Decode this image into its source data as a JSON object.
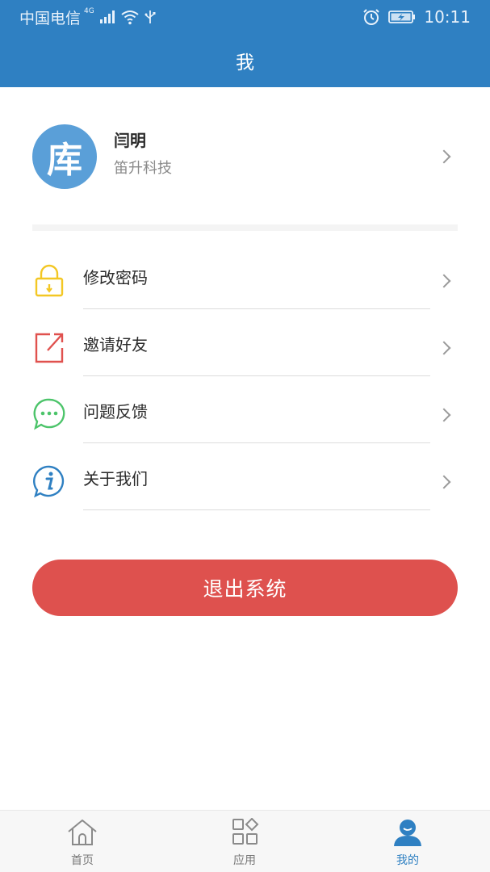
{
  "status_bar": {
    "carrier": "中国电信",
    "network": "4G",
    "time": "10:11"
  },
  "header": {
    "title": "我"
  },
  "profile": {
    "avatar_text": "库",
    "name": "闫明",
    "company": "笛升科技"
  },
  "menu": {
    "items": [
      {
        "label": "修改密码",
        "icon": "lock-icon",
        "color": "#f3c724"
      },
      {
        "label": "邀请好友",
        "icon": "share-icon",
        "color": "#e0514e"
      },
      {
        "label": "问题反馈",
        "icon": "chat-bubble-icon",
        "color": "#4cc46a"
      },
      {
        "label": "关于我们",
        "icon": "info-icon",
        "color": "#2f80c2"
      }
    ]
  },
  "logout": {
    "label": "退出系统"
  },
  "tabbar": {
    "items": [
      {
        "label": "首页",
        "icon": "home-icon",
        "active": false
      },
      {
        "label": "应用",
        "icon": "apps-grid-icon",
        "active": false
      },
      {
        "label": "我的",
        "icon": "user-icon",
        "active": true
      }
    ]
  },
  "colors": {
    "primary": "#2f80c2",
    "danger": "#de514e",
    "avatar": "#5a9fd8"
  }
}
